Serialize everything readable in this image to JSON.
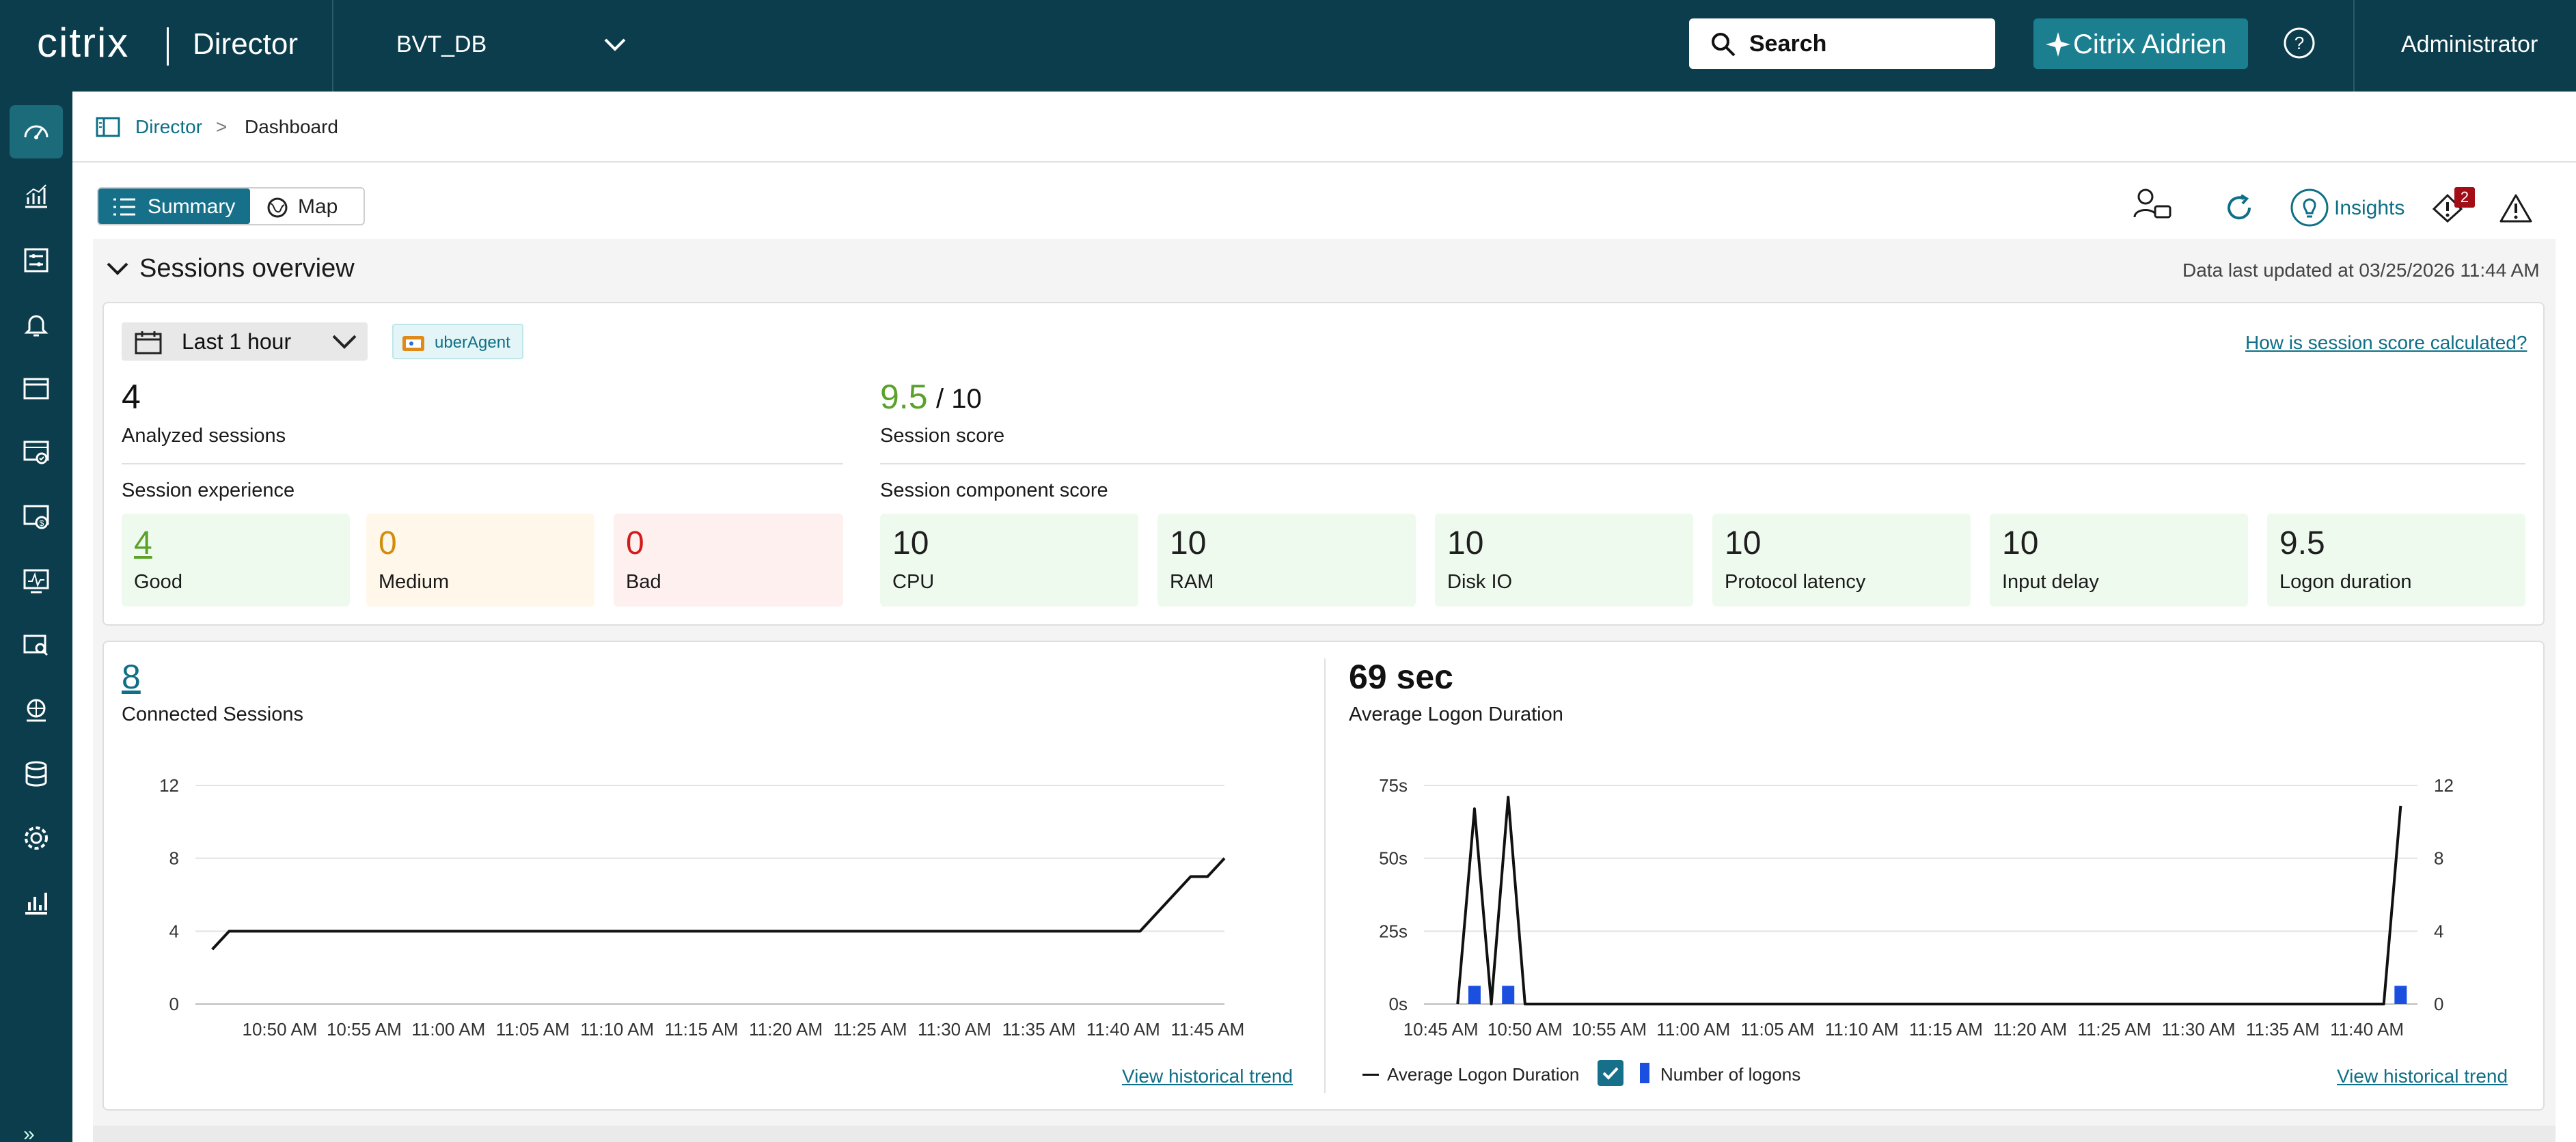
{
  "app": {
    "logo": "citrix",
    "name": "Director",
    "site": "BVT_DB",
    "search_label": "Search",
    "aidrien_label": "Citrix Aidrien",
    "user": "Administrator"
  },
  "nav": {
    "items": [
      "dashboard-icon",
      "trends-icon",
      "filters-icon",
      "alerts-icon",
      "applications-icon",
      "machines-icon",
      "costs-icon",
      "monitoring-icon",
      "search-icon",
      "network-icon",
      "database-icon",
      "settings-icon",
      "analytics-icon"
    ]
  },
  "breadcrumb": {
    "root": "Director",
    "separator": ">",
    "current": "Dashboard"
  },
  "toolbar": {
    "summary_label": "Summary",
    "map_label": "Map",
    "insights_label": "Insights",
    "notification_count": "2"
  },
  "sessions_overview": {
    "title": "Sessions overview",
    "updated": "Data last updated at 03/25/2026 11:44 AM",
    "time_range": "Last 1 hour",
    "source_tag": "uberAgent",
    "score_link": "How is session score calculated?",
    "analyzed_count": "4",
    "analyzed_label": "Analyzed sessions",
    "score_value": "9.5",
    "score_max": "/ 10",
    "score_label": "Session score",
    "experience_title": "Session experience",
    "experience": [
      {
        "value": "4",
        "label": "Good",
        "color": "#5aa22b"
      },
      {
        "value": "0",
        "label": "Medium",
        "color": "#d18d0b"
      },
      {
        "value": "0",
        "label": "Bad",
        "color": "#d21b1b"
      }
    ],
    "component_title": "Session component score",
    "components": [
      {
        "value": "10",
        "label": "CPU"
      },
      {
        "value": "10",
        "label": "RAM"
      },
      {
        "value": "10",
        "label": "Disk IO"
      },
      {
        "value": "10",
        "label": "Protocol latency"
      },
      {
        "value": "10",
        "label": "Input delay"
      },
      {
        "value": "9.5",
        "label": "Logon duration"
      }
    ]
  },
  "connected": {
    "value": "8",
    "label": "Connected Sessions",
    "trend_link": "View historical trend"
  },
  "logon": {
    "value": "69 sec",
    "label": "Average Logon Duration",
    "trend_link": "View historical trend",
    "legend_line": "Average Logon Duration",
    "legend_bar": "Number of logons"
  },
  "colors": {
    "brand": "#0c3d4c",
    "accent": "#17708a",
    "link": "#0e6f86",
    "bar": "#1a4fe0"
  },
  "chart_data": [
    {
      "type": "line",
      "title": "",
      "xlabel": "",
      "ylabel": "",
      "ylim": [
        0,
        12
      ],
      "y_ticks": [
        "0",
        "4",
        "8",
        "12"
      ],
      "x_ticks": [
        "10:50 AM",
        "10:55 AM",
        "11:00 AM",
        "11:05 AM",
        "11:10 AM",
        "11:15 AM",
        "11:20 AM",
        "11:25 AM",
        "11:30 AM",
        "11:35 AM",
        "11:40 AM",
        "11:45 AM"
      ],
      "grid": true,
      "series": [
        {
          "x": [
            "10:46 AM",
            "10:47 AM",
            "11:41 AM",
            "11:43 AM",
            "11:44 AM",
            "11:45 AM",
            "11:46 AM"
          ],
          "values": [
            3,
            4,
            4,
            6,
            7,
            7,
            8
          ]
        }
      ]
    },
    {
      "type": "line",
      "title": "",
      "xlabel": "",
      "ylabel": "",
      "ylim": [
        0,
        75
      ],
      "y2lim": [
        0,
        12
      ],
      "y_ticks": [
        "0s",
        "25s",
        "50s",
        "75s"
      ],
      "y2_ticks": [
        "0",
        "4",
        "8",
        "12"
      ],
      "x_ticks": [
        "10:45 AM",
        "10:50 AM",
        "10:55 AM",
        "11:00 AM",
        "11:05 AM",
        "11:10 AM",
        "11:15 AM",
        "11:20 AM",
        "11:25 AM",
        "11:30 AM",
        "11:35 AM",
        "11:40 AM"
      ],
      "grid": true,
      "legend": "bottom",
      "series": [
        {
          "name": "Average Logon Duration",
          "x": [
            "10:46 AM",
            "10:47 AM",
            "10:48 AM",
            "10:49 AM",
            "10:50 AM",
            "11:41 AM",
            "11:42 AM"
          ],
          "values": [
            0,
            67,
            0,
            71,
            0,
            0,
            68
          ]
        },
        {
          "name": "Number of logons",
          "type": "bar",
          "axis": "right",
          "x": [
            "10:47 AM",
            "10:49 AM",
            "11:42 AM"
          ],
          "values": [
            1,
            1,
            1
          ]
        }
      ]
    }
  ]
}
